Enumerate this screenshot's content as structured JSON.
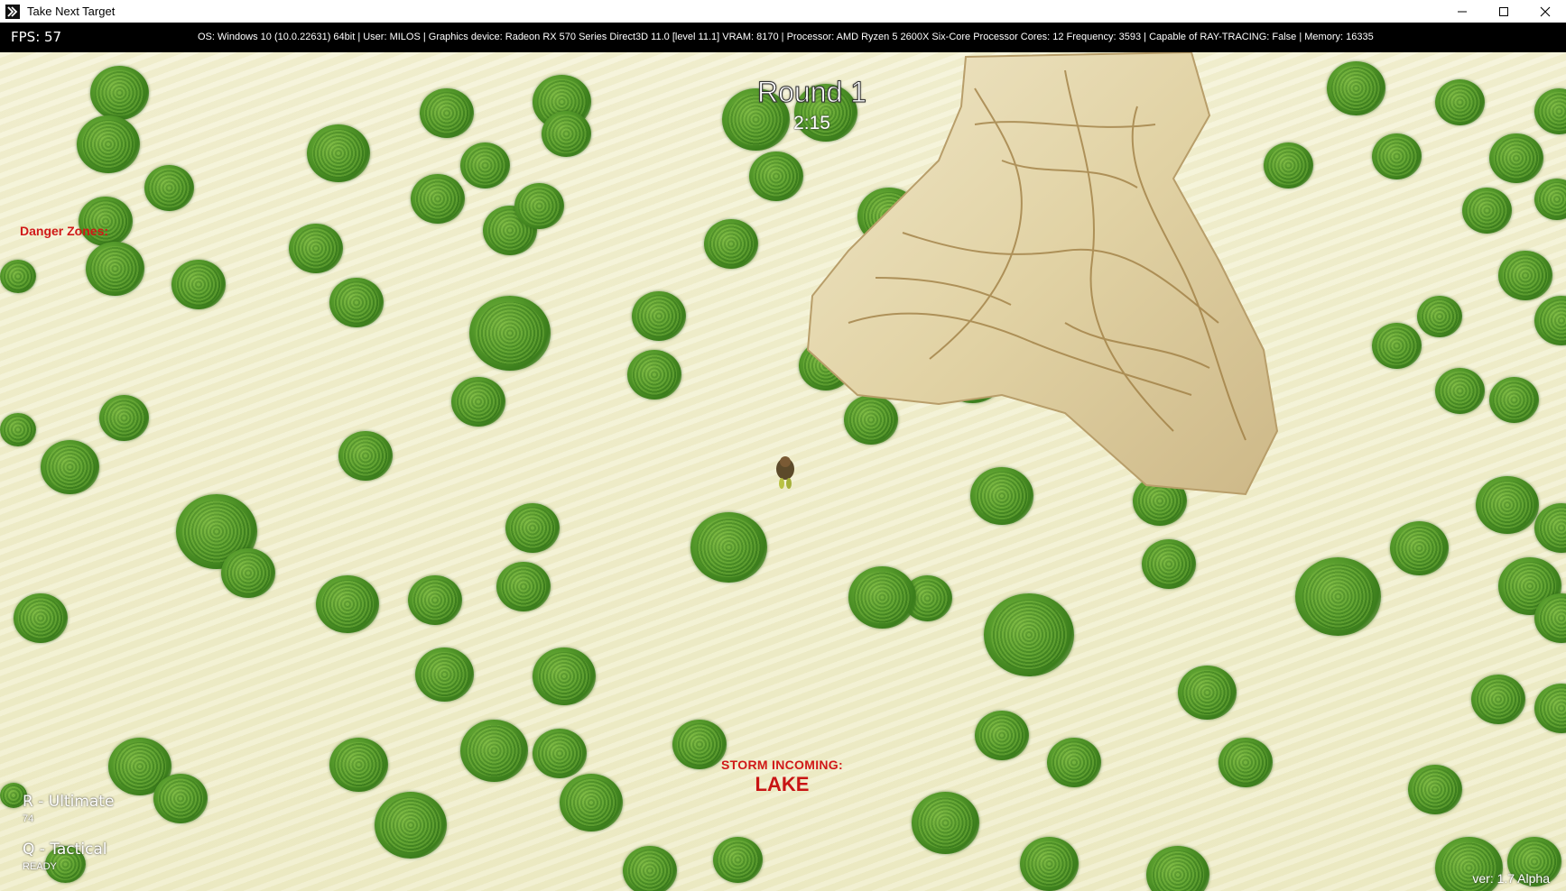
{
  "window": {
    "title": "Take Next Target"
  },
  "stats": {
    "fps": "FPS: 57",
    "system_info": "OS: Windows 10  (10.0.22631) 64bit | User: MILOS | Graphics device: Radeon RX 570 Series Direct3D 11.0 [level 11.1] VRAM: 8170 | Processor: AMD Ryzen 5 2600X Six-Core Processor  Cores: 12 Frequency: 3593 | Capable of RAY-TRACING: False | Memory: 16335"
  },
  "hud": {
    "round": "Round 1",
    "timer": "2:15",
    "danger_zones": "Danger Zones:",
    "storm_label": "STORM INCOMING:",
    "storm_location": "LAKE",
    "abilities": [
      {
        "key_label": "R - Ultimate",
        "status": "74"
      },
      {
        "key_label": "Q - Tactical",
        "status": "READY"
      }
    ],
    "version": "ver: 1.7 Alpha"
  },
  "colors": {
    "danger_red": "#d01818",
    "sand": "#f2f0cf",
    "bush_green": "#4f9326"
  }
}
